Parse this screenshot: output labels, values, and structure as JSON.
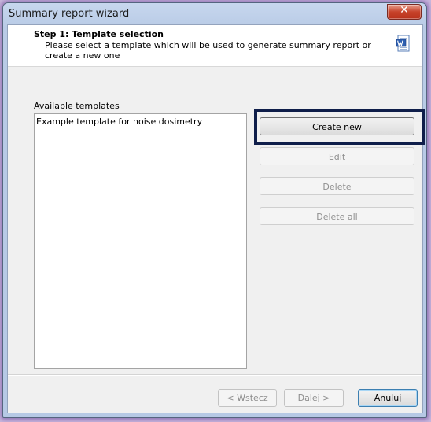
{
  "window": {
    "title": "Summary report wizard",
    "close_label": "✕"
  },
  "header": {
    "step_title": "Step 1: Template selection",
    "step_description": "Please select a template which will be used to generate summary report or create a new one",
    "icon": "word-document-icon"
  },
  "templates": {
    "label": "Available templates",
    "items": [
      "Example template for noise dosimetry"
    ]
  },
  "actions": {
    "create_new": "Create new",
    "edit": "Edit",
    "delete": "Delete",
    "delete_all": "Delete all"
  },
  "footer": {
    "back_prefix": "< ",
    "back_mnemonic": "W",
    "back_rest": "stecz",
    "next_mnemonic": "D",
    "next_rest": "alej >",
    "cancel_prefix": "Anul",
    "cancel_mnemonic": "u",
    "cancel_rest": "j"
  },
  "colors": {
    "highlight_border": "#0f1e4a",
    "close_button": "#c7432b",
    "focus_border": "#3c7fb1"
  }
}
